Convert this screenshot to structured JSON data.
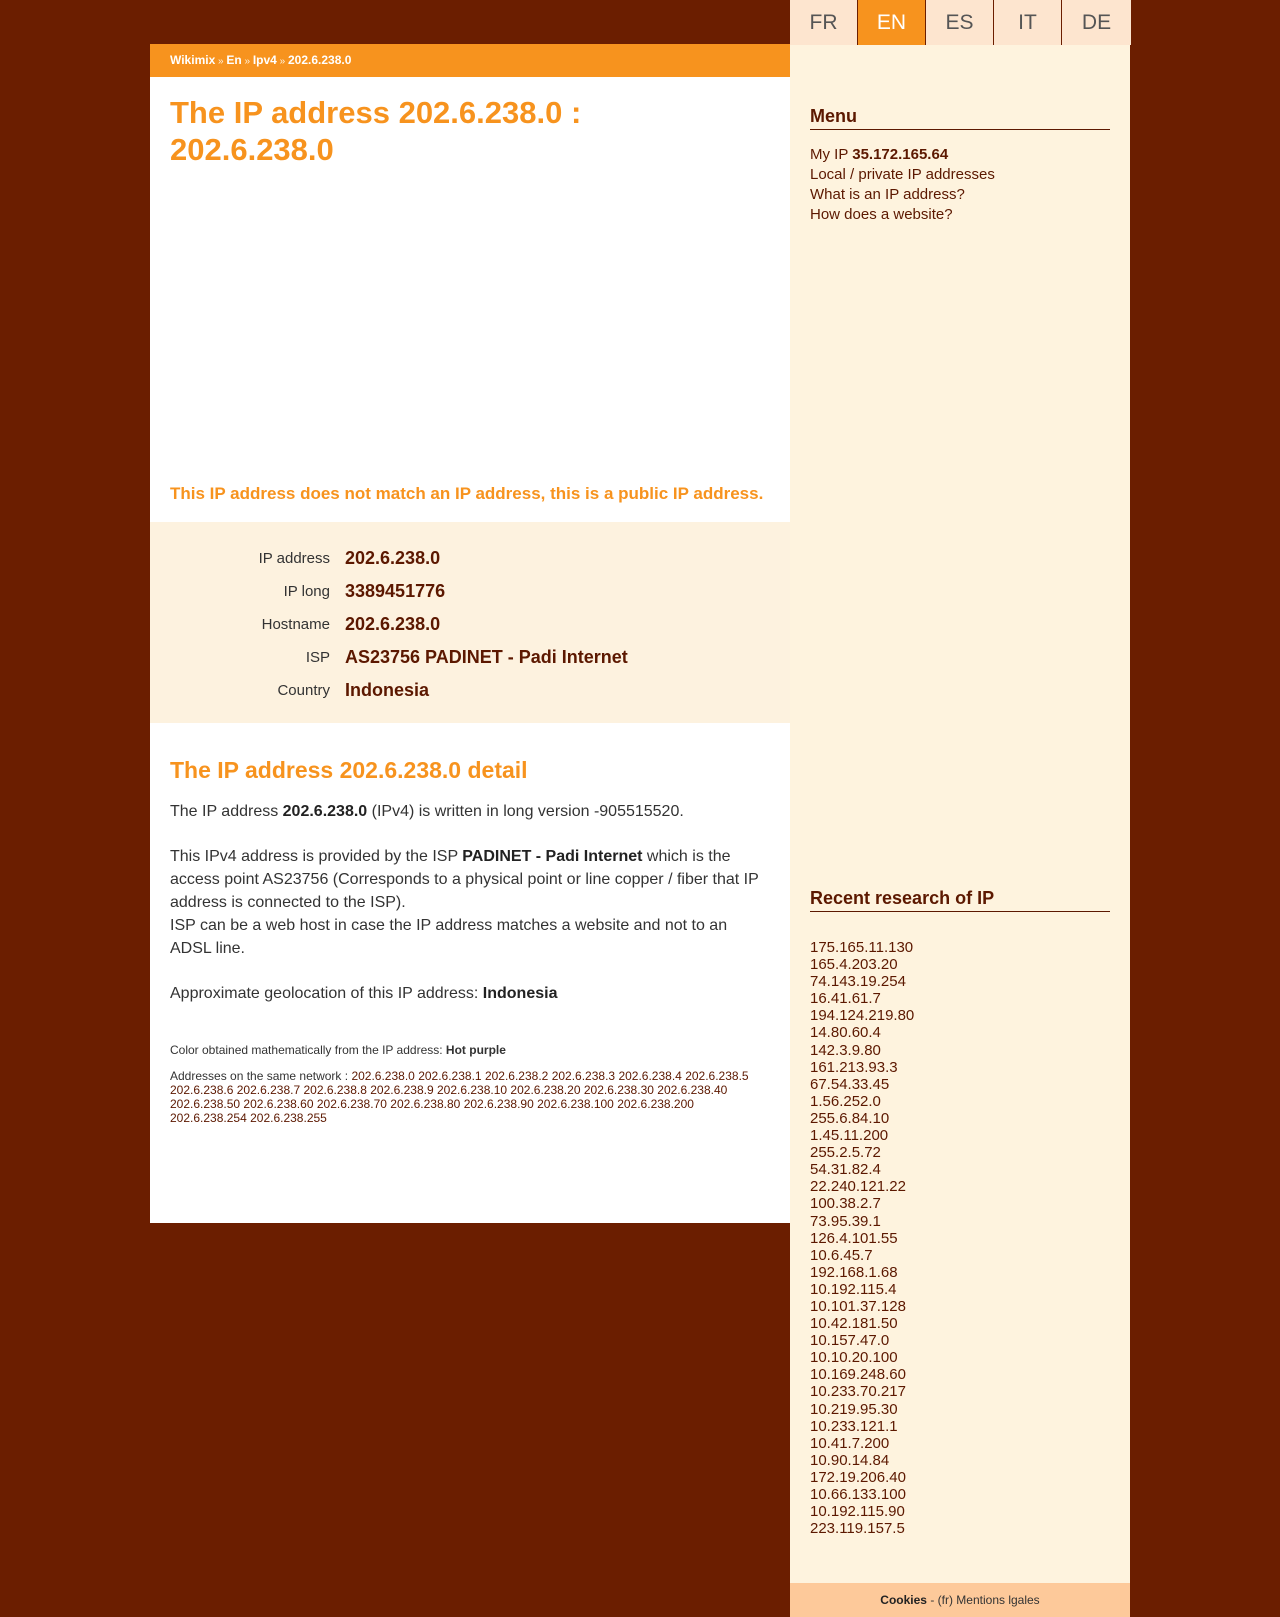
{
  "breadcrumb": {
    "items": [
      "Wikimix",
      "En",
      "Ipv4",
      "202.6.238.0"
    ],
    "separator": "»"
  },
  "languages": [
    {
      "code": "FR",
      "active": false
    },
    {
      "code": "EN",
      "active": true
    },
    {
      "code": "ES",
      "active": false
    },
    {
      "code": "IT",
      "active": false
    },
    {
      "code": "DE",
      "active": false
    }
  ],
  "title": {
    "line1": "The IP address 202.6.238.0 :",
    "line2": "202.6.238.0"
  },
  "public_note": "This IP address does not match an IP address, this is a public IP address.",
  "info": [
    {
      "label": "IP address",
      "value": "202.6.238.0"
    },
    {
      "label": "IP long",
      "value": "3389451776"
    },
    {
      "label": "Hostname",
      "value": "202.6.238.0"
    },
    {
      "label": "ISP",
      "value": "AS23756 PADINET - Padi Internet"
    },
    {
      "label": "Country",
      "value": "Indonesia"
    }
  ],
  "detail": {
    "title": "The IP address 202.6.238.0 detail",
    "p1": {
      "pre": "The IP address ",
      "ip": "202.6.238.0",
      "post": " (IPv4) is written in long version -905515520."
    },
    "p2": {
      "pre": "This IPv4 address is provided by the ISP ",
      "isp": "PADINET - Padi Internet",
      "post": " which is the access point AS23756 (Corresponds to a physical point or line copper / fiber that IP address is connected to the ISP)."
    },
    "p3": "ISP can be a web host in case the IP address matches a website and not to an ADSL line.",
    "p4": {
      "pre": "Approximate geolocation of this IP address: ",
      "country": "Indonesia"
    },
    "color_note": {
      "pre": "Color obtained mathematically from the IP address: ",
      "color": "Hot purple"
    },
    "network_label": "Addresses on the same network : ",
    "network": [
      "202.6.238.0",
      "202.6.238.1",
      "202.6.238.2",
      "202.6.238.3",
      "202.6.238.4",
      "202.6.238.5",
      "202.6.238.6",
      "202.6.238.7",
      "202.6.238.8",
      "202.6.238.9",
      "202.6.238.10",
      "202.6.238.20",
      "202.6.238.30",
      "202.6.238.40",
      "202.6.238.50",
      "202.6.238.60",
      "202.6.238.70",
      "202.6.238.80",
      "202.6.238.90",
      "202.6.238.100",
      "202.6.238.200",
      "202.6.238.254",
      "202.6.238.255"
    ]
  },
  "sidebar": {
    "menu_title": "Menu",
    "menu": {
      "my_ip_label": "My IP ",
      "my_ip_value": "35.172.165.64",
      "items": [
        "Local / private IP addresses",
        "What is an IP address?",
        "How does a website?"
      ]
    },
    "recent_title": "Recent research of IP",
    "recent": [
      "175.165.11.130",
      "165.4.203.20",
      "74.143.19.254",
      "16.41.61.7",
      "194.124.219.80",
      "14.80.60.4",
      "142.3.9.80",
      "161.213.93.3",
      "67.54.33.45",
      "1.56.252.0",
      "255.6.84.10",
      "1.45.11.200",
      "255.2.5.72",
      "54.31.82.4",
      "22.240.121.22",
      "100.38.2.7",
      "73.95.39.1",
      "126.4.101.55",
      "10.6.45.7",
      "192.168.1.68",
      "10.192.115.4",
      "10.101.37.128",
      "10.42.181.50",
      "10.157.47.0",
      "10.10.20.100",
      "10.169.248.60",
      "10.233.70.217",
      "10.219.95.30",
      "10.233.121.1",
      "10.41.7.200",
      "10.90.14.84",
      "172.19.206.40",
      "10.66.133.100",
      "10.192.115.90",
      "223.119.157.5"
    ]
  },
  "footer": {
    "cookies": "Cookies",
    "rest": " - (fr) Mentions lgales"
  }
}
